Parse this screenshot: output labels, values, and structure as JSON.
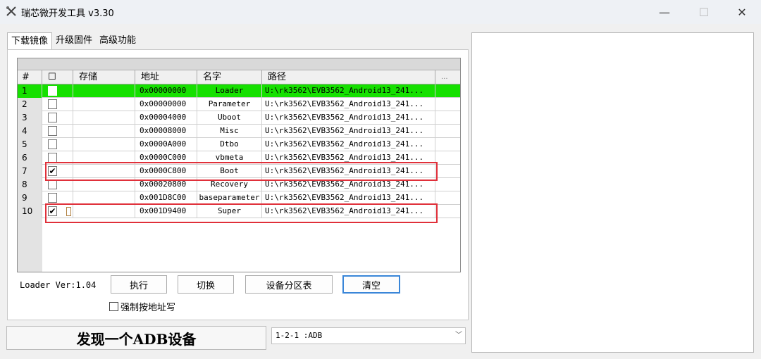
{
  "window": {
    "title": "瑞芯微开发工具 v3.30",
    "minimize_glyph": "—",
    "maximize_glyph": "☐",
    "close_glyph": "✕"
  },
  "tabs": [
    {
      "label": "下载镜像",
      "active": true
    },
    {
      "label": "升级固件",
      "active": false
    },
    {
      "label": "高级功能",
      "active": false
    }
  ],
  "table": {
    "headers": {
      "num": "#",
      "check": "☐",
      "storage": "存储",
      "address": "地址",
      "name": "名字",
      "path": "路径",
      "extra": "..."
    },
    "rows": [
      {
        "num": "1",
        "checked": false,
        "address": "0x00000000",
        "name": "Loader",
        "path": "U:\\rk3562\\EVB3562_Android13_241...",
        "highlight": "green"
      },
      {
        "num": "2",
        "checked": false,
        "address": "0x00000000",
        "name": "Parameter",
        "path": "U:\\rk3562\\EVB3562_Android13_241..."
      },
      {
        "num": "3",
        "checked": false,
        "address": "0x00004000",
        "name": "Uboot",
        "path": "U:\\rk3562\\EVB3562_Android13_241..."
      },
      {
        "num": "4",
        "checked": false,
        "address": "0x00008000",
        "name": "Misc",
        "path": "U:\\rk3562\\EVB3562_Android13_241..."
      },
      {
        "num": "5",
        "checked": false,
        "address": "0x0000A000",
        "name": "Dtbo",
        "path": "U:\\rk3562\\EVB3562_Android13_241..."
      },
      {
        "num": "6",
        "checked": false,
        "address": "0x0000C000",
        "name": "vbmeta",
        "path": "U:\\rk3562\\EVB3562_Android13_241..."
      },
      {
        "num": "7",
        "checked": true,
        "address": "0x0000C800",
        "name": "Boot",
        "path": "U:\\rk3562\\EVB3562_Android13_241...",
        "boxed": true
      },
      {
        "num": "8",
        "checked": false,
        "address": "0x00020800",
        "name": "Recovery",
        "path": "U:\\rk3562\\EVB3562_Android13_241..."
      },
      {
        "num": "9",
        "checked": false,
        "address": "0x001D8C00",
        "name": "baseparameter",
        "path": "U:\\rk3562\\EVB3562_Android13_241..."
      },
      {
        "num": "10",
        "checked": true,
        "address": "0x001D9400",
        "name": "Super",
        "path": "U:\\rk3562\\EVB3562_Android13_241...",
        "boxed": true
      }
    ]
  },
  "loader_version": "Loader Ver:1.04",
  "buttons": {
    "execute": "执行",
    "switch": "切换",
    "partition_table": "设备分区表",
    "clear": "清空"
  },
  "force_address_write": {
    "label": "强制按地址写",
    "checked": false
  },
  "status_text": "发现一个ADB设备",
  "device_select": {
    "value": "1-2-1 :ADB"
  },
  "colors": {
    "highlight_row": "#16e000",
    "annotation_box": "#e0303a"
  }
}
